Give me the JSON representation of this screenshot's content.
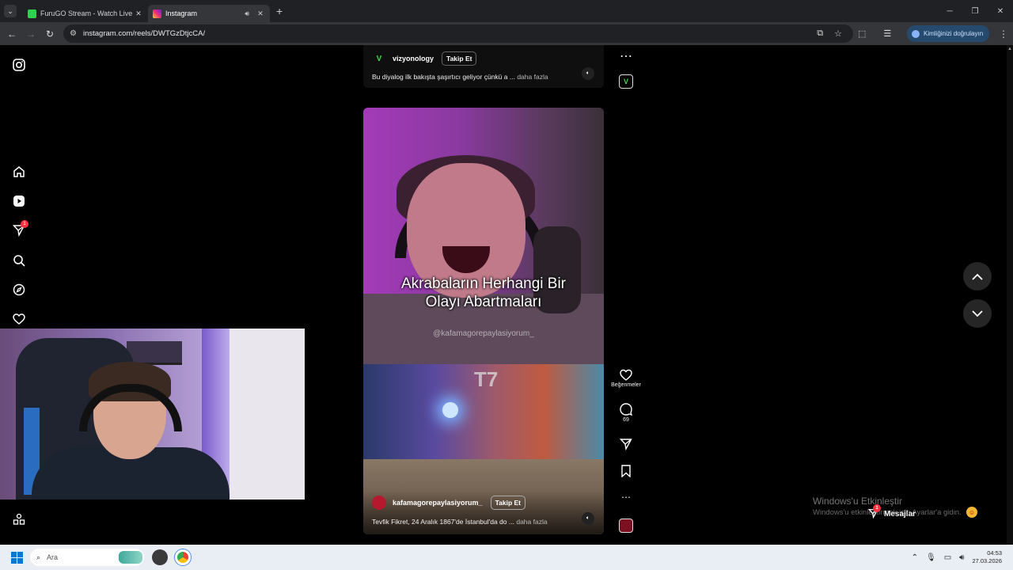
{
  "browser": {
    "tabs": [
      {
        "title": "FuruGO Stream - Watch Live o",
        "favicon_color": "#2bd34f",
        "active": false
      },
      {
        "title": "Instagram",
        "favicon_color": "#e1306c",
        "active": true
      }
    ],
    "url": "instagram.com/reels/DWTGzDtjcCA/",
    "verify_label": "Kimliğinizi doğrulayın"
  },
  "sidebar": {
    "items": [
      "instagram-logo-icon",
      "home-icon",
      "reels-icon",
      "messages-icon",
      "search-icon",
      "explore-icon",
      "notifications-icon"
    ],
    "messages_badge": "1"
  },
  "reel_top": {
    "username": "vizyonology",
    "follow_label": "Takip Et",
    "caption": "Bu diyalog ilk bakışta şaşırtıcı geliyor çünkü a ...",
    "more_label": "daha fazla",
    "avatar_letter": "V",
    "avatar_color": "#3ddc4a"
  },
  "reel_main": {
    "overlay_line1": "Akrabaların Herhangi Bir",
    "overlay_line2": "Olayı Abartmaları",
    "watermark_handle": "@kafamagorepaylasiyorum_",
    "bottom_logo": "T7",
    "username": "kafamagorepaylasiyorum_",
    "follow_label": "Takip Et",
    "caption": "Tevfik Fikret, 24 Aralık 1867'de İstanbul'da do ...",
    "more_label": "daha fazla",
    "avatar_color": "#b5192e"
  },
  "actions": {
    "likes_label": "Beğenmeler",
    "comments_count": "69"
  },
  "overlay_texts": {
    "windows_activate": "Windows'u Etkinleştir",
    "windows_activate_sub": "Windows'u etkinleştirmek için Ayarlar'a gidin.",
    "messages_label": "Mesajlar",
    "messages_badge": "1"
  },
  "taskbar": {
    "search_placeholder": "Ara",
    "time": "04:53",
    "date": "27.03.2026"
  }
}
